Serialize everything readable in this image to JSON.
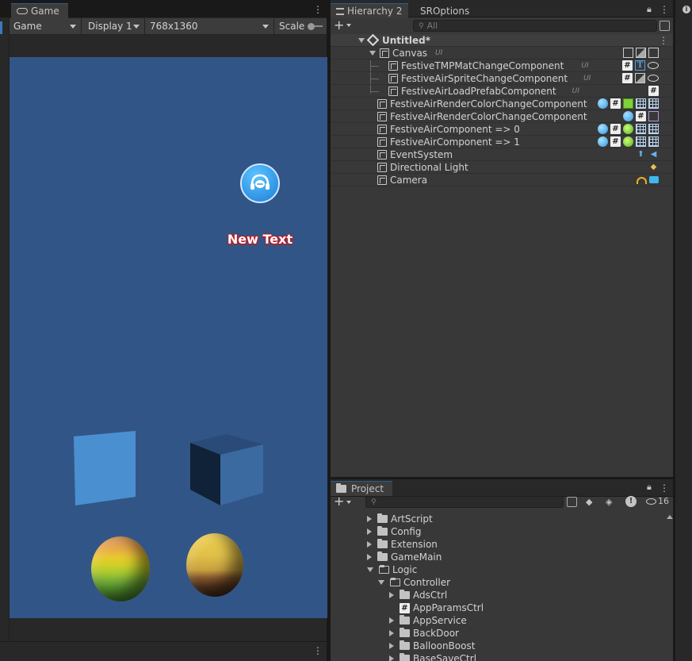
{
  "game": {
    "tab_label": "Game",
    "toolbar": {
      "mode": "Game",
      "display": "Display 1",
      "resolution": "768x1360",
      "scale_label": "Scale"
    },
    "view": {
      "bg_color": "#325587",
      "button_icon": "headset-chat-icon",
      "new_text": "New Text"
    }
  },
  "hierarchy": {
    "tabs": [
      "Hierarchy 2",
      "SROptions"
    ],
    "search_placeholder": "All",
    "scene_name": "Untitled*",
    "rows": [
      {
        "name": "Canvas",
        "ui": "UI",
        "icons": [
          "frame-icon",
          "image-icon",
          "canvas-icon"
        ]
      },
      {
        "name": "FestiveTMPMatChangeComponent",
        "ui": "UI",
        "icons": [
          "script-icon",
          "text-icon",
          "eye-icon"
        ]
      },
      {
        "name": "FestiveAirSpriteChangeComponent",
        "ui": "UI",
        "icons": [
          "script-icon",
          "image-icon",
          "eye-icon"
        ]
      },
      {
        "name": "FestiveAirLoadPrefabComponent",
        "ui": "UI",
        "icons": [
          "script-icon"
        ]
      },
      {
        "name": "FestiveAirRenderColorChangeComponent",
        "ui": "",
        "icons": [
          "material-icon",
          "script-icon",
          "box-collider-icon",
          "grid-icon",
          "grid-icon"
        ]
      },
      {
        "name": "FestiveAirRenderColorChangeComponent",
        "ui": "",
        "icons": [
          "material-icon",
          "script-icon",
          "mesh-icon"
        ]
      },
      {
        "name": "FestiveAirComponent => 0",
        "ui": "",
        "icons": [
          "material-icon",
          "script-icon",
          "sphere-icon",
          "grid-icon",
          "grid-icon"
        ]
      },
      {
        "name": "FestiveAirComponent => 1",
        "ui": "",
        "icons": [
          "material-icon",
          "script-icon",
          "sphere-icon",
          "grid-icon",
          "grid-icon"
        ]
      },
      {
        "name": "EventSystem",
        "ui": "",
        "icons": [
          "event-system-icon",
          "input-icon"
        ]
      },
      {
        "name": "Directional Light",
        "ui": "",
        "icons": [
          "light-icon"
        ]
      },
      {
        "name": "Camera",
        "ui": "",
        "icons": [
          "audio-listener-icon",
          "camera-icon"
        ]
      }
    ]
  },
  "project": {
    "tab_label": "Project",
    "hidden_count": "16",
    "items": [
      {
        "label": "ArtScript",
        "depth": 0,
        "expanded": false,
        "type": "folder"
      },
      {
        "label": "Config",
        "depth": 0,
        "expanded": false,
        "type": "folder"
      },
      {
        "label": "Extension",
        "depth": 0,
        "expanded": false,
        "type": "folder"
      },
      {
        "label": "GameMain",
        "depth": 0,
        "expanded": false,
        "type": "folder"
      },
      {
        "label": "Logic",
        "depth": 0,
        "expanded": true,
        "type": "folder"
      },
      {
        "label": "Controller",
        "depth": 1,
        "expanded": true,
        "type": "folder"
      },
      {
        "label": "AdsCtrl",
        "depth": 2,
        "expanded": false,
        "type": "folder"
      },
      {
        "label": "AppParamsCtrl",
        "depth": 2,
        "expanded": false,
        "type": "script"
      },
      {
        "label": "AppService",
        "depth": 2,
        "expanded": false,
        "type": "folder"
      },
      {
        "label": "BackDoor",
        "depth": 2,
        "expanded": false,
        "type": "folder"
      },
      {
        "label": "BalloonBoost",
        "depth": 2,
        "expanded": false,
        "type": "folder"
      },
      {
        "label": "BaseSaveCtrl",
        "depth": 2,
        "expanded": false,
        "type": "folder"
      }
    ]
  }
}
